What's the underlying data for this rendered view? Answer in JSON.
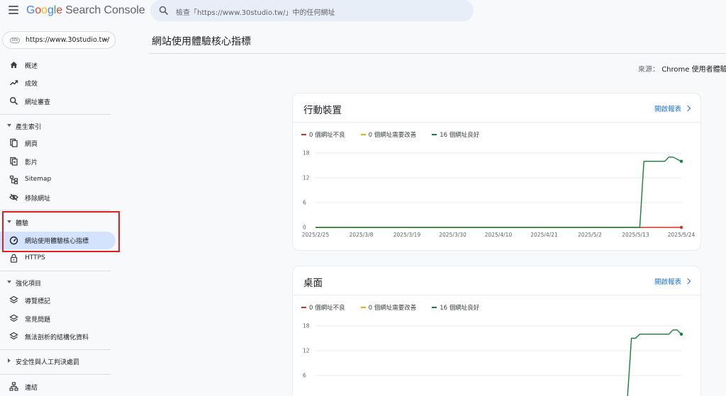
{
  "app": {
    "logo_google": [
      "G",
      "o",
      "o",
      "g",
      "l",
      "e"
    ],
    "logo_product": "Search Console",
    "search_placeholder": "檢查「https://www.30studio.tw/」中的任何網址"
  },
  "property": {
    "favicon_text": "30s",
    "url": "https://www.30studio.tw/"
  },
  "sidebar": {
    "overview": "概述",
    "performance": "成效",
    "url_inspection": "網址審查",
    "indexing_section": "產生索引",
    "pages": "網頁",
    "videos": "影片",
    "sitemaps": "Sitemap",
    "removals": "移除網址",
    "experience_section": "體驗",
    "core_web_vitals": "網站使用體驗核心指標",
    "https": "HTTPS",
    "enhancements_section": "強化項目",
    "breadcrumbs": "導覽標記",
    "faq": "常見問題",
    "unparsable": "無法剖析的結構化資料",
    "security_section": "安全性與人工判決處罰",
    "links": "連結"
  },
  "main": {
    "page_title": "網站使用體驗核心指標",
    "source_label": "來源：",
    "source_value": "Chrome 使用者體驗"
  },
  "colors": {
    "poor": "#d93025",
    "needs_improvement": "#f9ab00",
    "good": "#188038",
    "accent": "#1a73e8"
  },
  "cards": [
    {
      "title": "行動裝置",
      "open_report": "開啟報表",
      "legend": [
        "0 個網址不良",
        "0 個網址需要改善",
        "16 個網址良好"
      ]
    },
    {
      "title": "桌面",
      "open_report": "開啟報表",
      "legend": [
        "0 個網址不良",
        "0 個網址需要改善",
        "16 個網址良好"
      ]
    }
  ],
  "chart_data": [
    {
      "type": "line",
      "title": "行動裝置",
      "x_ticks": [
        "2025/2/25",
        "2025/3/8",
        "2025/3/19",
        "2025/3/30",
        "2025/4/10",
        "2025/4/21",
        "2025/5/2",
        "2025/5/13",
        "2025/5/24"
      ],
      "y_ticks": [
        0,
        6,
        12,
        18
      ],
      "ylim": [
        0,
        18
      ],
      "xlim": [
        "2025/2/25",
        "2025/5/24"
      ],
      "grid": true,
      "legend_position": "top-left",
      "series": [
        {
          "name": "0 個網址不良",
          "color": "#d93025",
          "x": [
            "2025/2/25",
            "2025/5/24"
          ],
          "y": [
            0,
            0
          ]
        },
        {
          "name": "16 個網址良好",
          "color": "#188038",
          "x": [
            "2025/2/25",
            "2025/5/14",
            "2025/5/15",
            "2025/5/19",
            "2025/5/20",
            "2025/5/21",
            "2025/5/22",
            "2025/5/24"
          ],
          "y": [
            0,
            0,
            16,
            16,
            16,
            17,
            17,
            16
          ]
        }
      ]
    },
    {
      "type": "line",
      "title": "桌面",
      "x_ticks": [],
      "y_ticks": [
        6,
        12,
        18
      ],
      "ylim": [
        0,
        18
      ],
      "xlim": [
        "2025/2/25",
        "2025/5/24"
      ],
      "grid": true,
      "legend_position": "top-left",
      "series": [
        {
          "name": "16 個網址良好",
          "color": "#188038",
          "x": [
            "2025/5/11",
            "2025/5/12",
            "2025/5/13",
            "2025/5/14",
            "2025/5/15",
            "2025/5/21",
            "2025/5/22",
            "2025/5/23",
            "2025/5/24"
          ],
          "y": [
            0,
            15,
            15,
            16,
            16,
            16,
            17,
            17,
            16
          ]
        }
      ]
    }
  ]
}
